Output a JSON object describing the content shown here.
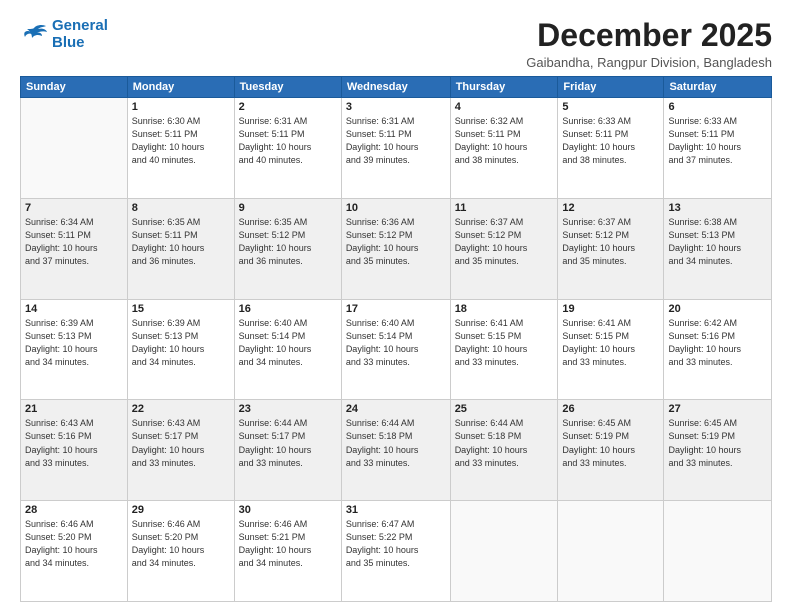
{
  "logo": {
    "line1": "General",
    "line2": "Blue"
  },
  "title": "December 2025",
  "subtitle": "Gaibandha, Rangpur Division, Bangladesh",
  "weekdays": [
    "Sunday",
    "Monday",
    "Tuesday",
    "Wednesday",
    "Thursday",
    "Friday",
    "Saturday"
  ],
  "weeks": [
    [
      {
        "day": "",
        "info": ""
      },
      {
        "day": "1",
        "info": "Sunrise: 6:30 AM\nSunset: 5:11 PM\nDaylight: 10 hours\nand 40 minutes."
      },
      {
        "day": "2",
        "info": "Sunrise: 6:31 AM\nSunset: 5:11 PM\nDaylight: 10 hours\nand 40 minutes."
      },
      {
        "day": "3",
        "info": "Sunrise: 6:31 AM\nSunset: 5:11 PM\nDaylight: 10 hours\nand 39 minutes."
      },
      {
        "day": "4",
        "info": "Sunrise: 6:32 AM\nSunset: 5:11 PM\nDaylight: 10 hours\nand 38 minutes."
      },
      {
        "day": "5",
        "info": "Sunrise: 6:33 AM\nSunset: 5:11 PM\nDaylight: 10 hours\nand 38 minutes."
      },
      {
        "day": "6",
        "info": "Sunrise: 6:33 AM\nSunset: 5:11 PM\nDaylight: 10 hours\nand 37 minutes."
      }
    ],
    [
      {
        "day": "7",
        "info": "Sunrise: 6:34 AM\nSunset: 5:11 PM\nDaylight: 10 hours\nand 37 minutes."
      },
      {
        "day": "8",
        "info": "Sunrise: 6:35 AM\nSunset: 5:11 PM\nDaylight: 10 hours\nand 36 minutes."
      },
      {
        "day": "9",
        "info": "Sunrise: 6:35 AM\nSunset: 5:12 PM\nDaylight: 10 hours\nand 36 minutes."
      },
      {
        "day": "10",
        "info": "Sunrise: 6:36 AM\nSunset: 5:12 PM\nDaylight: 10 hours\nand 35 minutes."
      },
      {
        "day": "11",
        "info": "Sunrise: 6:37 AM\nSunset: 5:12 PM\nDaylight: 10 hours\nand 35 minutes."
      },
      {
        "day": "12",
        "info": "Sunrise: 6:37 AM\nSunset: 5:12 PM\nDaylight: 10 hours\nand 35 minutes."
      },
      {
        "day": "13",
        "info": "Sunrise: 6:38 AM\nSunset: 5:13 PM\nDaylight: 10 hours\nand 34 minutes."
      }
    ],
    [
      {
        "day": "14",
        "info": "Sunrise: 6:39 AM\nSunset: 5:13 PM\nDaylight: 10 hours\nand 34 minutes."
      },
      {
        "day": "15",
        "info": "Sunrise: 6:39 AM\nSunset: 5:13 PM\nDaylight: 10 hours\nand 34 minutes."
      },
      {
        "day": "16",
        "info": "Sunrise: 6:40 AM\nSunset: 5:14 PM\nDaylight: 10 hours\nand 34 minutes."
      },
      {
        "day": "17",
        "info": "Sunrise: 6:40 AM\nSunset: 5:14 PM\nDaylight: 10 hours\nand 33 minutes."
      },
      {
        "day": "18",
        "info": "Sunrise: 6:41 AM\nSunset: 5:15 PM\nDaylight: 10 hours\nand 33 minutes."
      },
      {
        "day": "19",
        "info": "Sunrise: 6:41 AM\nSunset: 5:15 PM\nDaylight: 10 hours\nand 33 minutes."
      },
      {
        "day": "20",
        "info": "Sunrise: 6:42 AM\nSunset: 5:16 PM\nDaylight: 10 hours\nand 33 minutes."
      }
    ],
    [
      {
        "day": "21",
        "info": "Sunrise: 6:43 AM\nSunset: 5:16 PM\nDaylight: 10 hours\nand 33 minutes."
      },
      {
        "day": "22",
        "info": "Sunrise: 6:43 AM\nSunset: 5:17 PM\nDaylight: 10 hours\nand 33 minutes."
      },
      {
        "day": "23",
        "info": "Sunrise: 6:44 AM\nSunset: 5:17 PM\nDaylight: 10 hours\nand 33 minutes."
      },
      {
        "day": "24",
        "info": "Sunrise: 6:44 AM\nSunset: 5:18 PM\nDaylight: 10 hours\nand 33 minutes."
      },
      {
        "day": "25",
        "info": "Sunrise: 6:44 AM\nSunset: 5:18 PM\nDaylight: 10 hours\nand 33 minutes."
      },
      {
        "day": "26",
        "info": "Sunrise: 6:45 AM\nSunset: 5:19 PM\nDaylight: 10 hours\nand 33 minutes."
      },
      {
        "day": "27",
        "info": "Sunrise: 6:45 AM\nSunset: 5:19 PM\nDaylight: 10 hours\nand 33 minutes."
      }
    ],
    [
      {
        "day": "28",
        "info": "Sunrise: 6:46 AM\nSunset: 5:20 PM\nDaylight: 10 hours\nand 34 minutes."
      },
      {
        "day": "29",
        "info": "Sunrise: 6:46 AM\nSunset: 5:20 PM\nDaylight: 10 hours\nand 34 minutes."
      },
      {
        "day": "30",
        "info": "Sunrise: 6:46 AM\nSunset: 5:21 PM\nDaylight: 10 hours\nand 34 minutes."
      },
      {
        "day": "31",
        "info": "Sunrise: 6:47 AM\nSunset: 5:22 PM\nDaylight: 10 hours\nand 35 minutes."
      },
      {
        "day": "",
        "info": ""
      },
      {
        "day": "",
        "info": ""
      },
      {
        "day": "",
        "info": ""
      }
    ]
  ]
}
